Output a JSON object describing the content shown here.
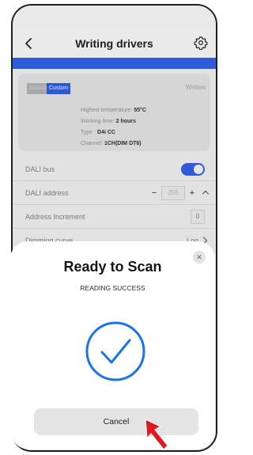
{
  "header": {
    "title": "Writing drivers",
    "back_icon": "chevron-left-icon",
    "settings_icon": "gear-icon"
  },
  "driver_card": {
    "tag_standard": "Standard",
    "tag_custom": "Custom",
    "status": "Written",
    "info": [
      {
        "label": "Highest temperature: ",
        "value": "55°C"
      },
      {
        "label": "Working time: ",
        "value": "2 hours"
      },
      {
        "label": "Type : ",
        "value": "D4i CC"
      },
      {
        "label": "Channel: ",
        "value": "1CH(DIM DT6)"
      }
    ]
  },
  "settings": {
    "dali_bus": {
      "label": "DALI bus",
      "enabled": true
    },
    "dali_address": {
      "label": "DALI address",
      "minus": "−",
      "value": "255",
      "plus": "+"
    },
    "address_increment": {
      "label": "Address Increment",
      "value": "0"
    },
    "dimming_curve": {
      "label": "Dimming curve",
      "value": "Log"
    }
  },
  "scan_sheet": {
    "title": "Ready to Scan",
    "message": "READING SUCCESS",
    "close_icon": "✕",
    "cancel_label": "Cancel"
  },
  "colors": {
    "accent_blue": "#2f5ad8",
    "success_blue": "#1a73e8",
    "cursor_red": "#e0191f"
  }
}
